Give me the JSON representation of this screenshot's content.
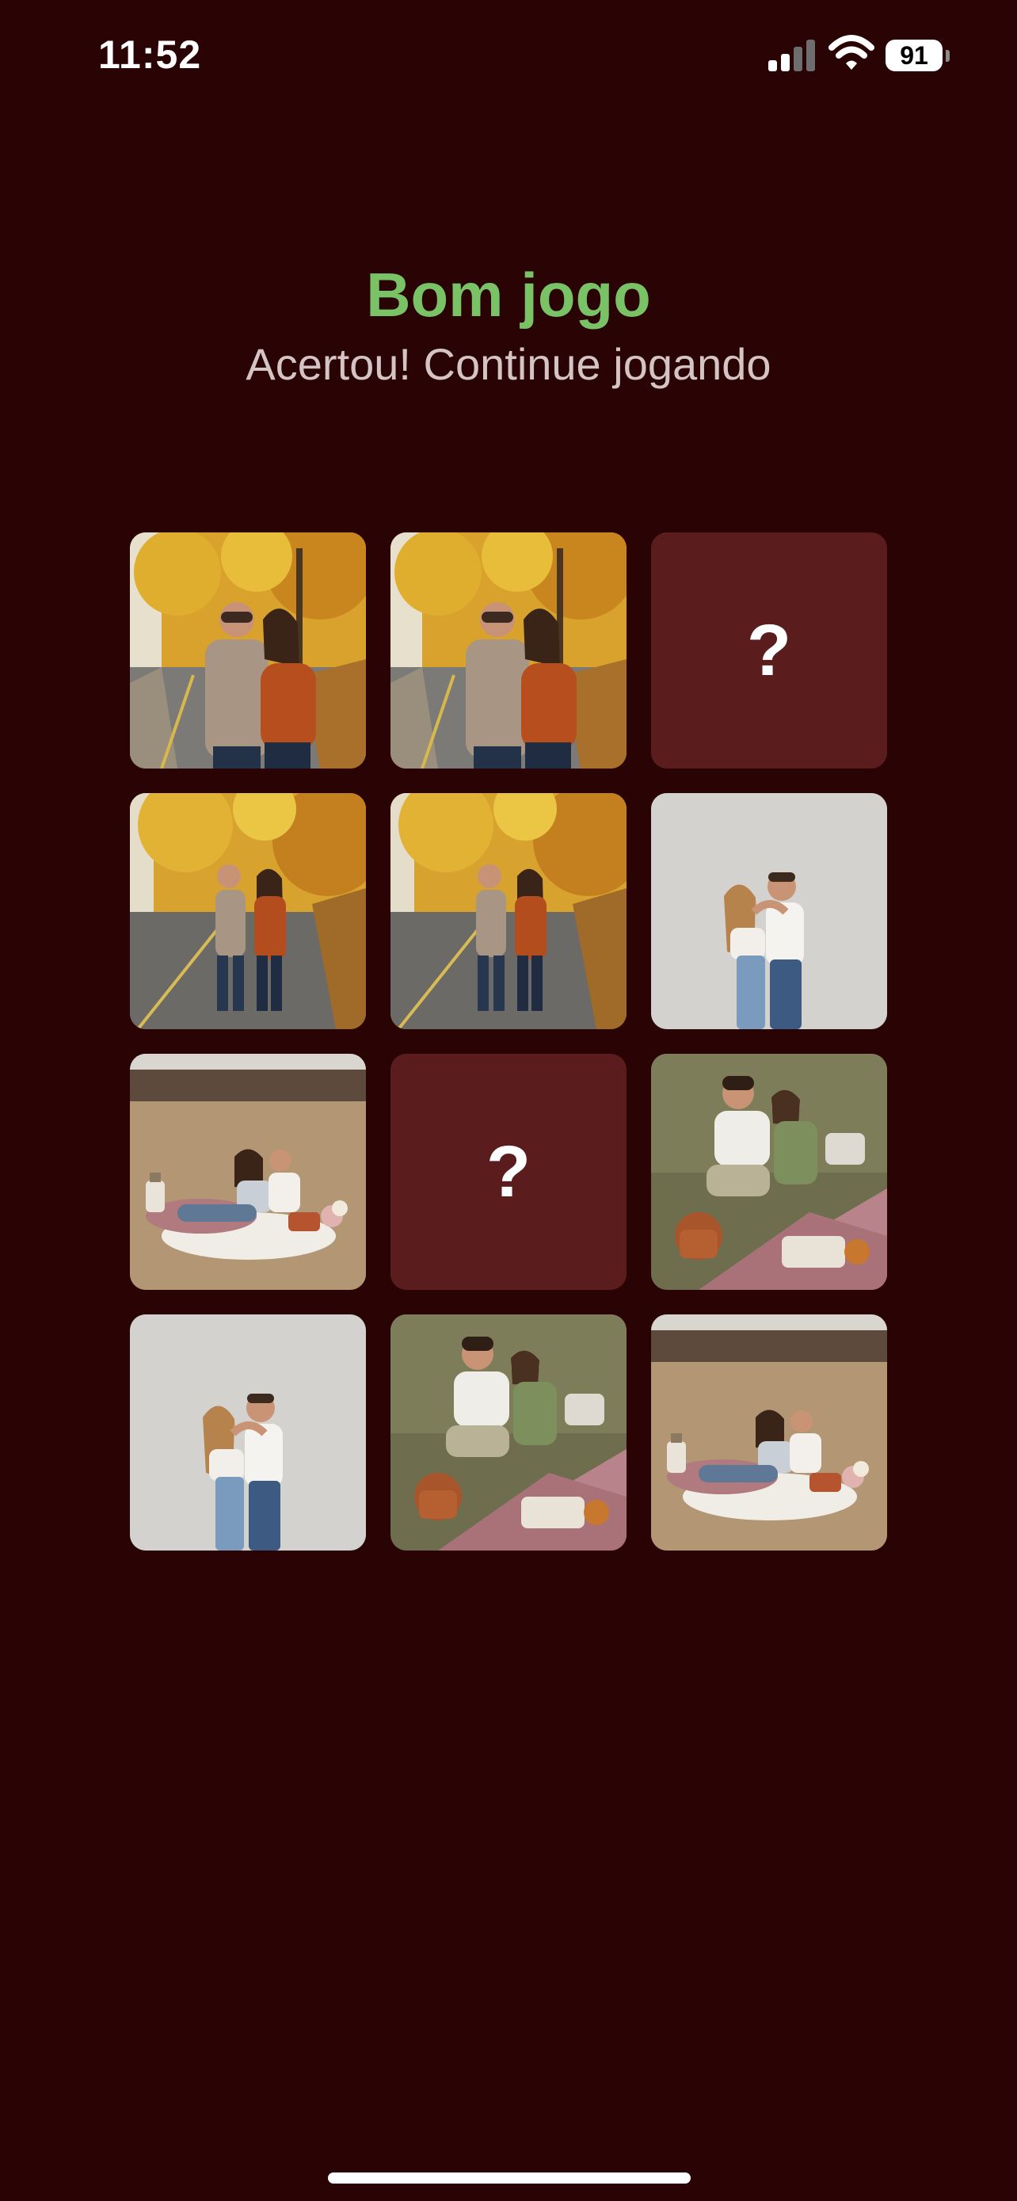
{
  "status_bar": {
    "time": "11:52",
    "battery": "91",
    "icons": [
      "signal-icon",
      "wifi-icon",
      "battery-icon"
    ]
  },
  "header": {
    "title": "Bom jogo",
    "subtitle": "Acertou! Continue jogando"
  },
  "board": {
    "cards": [
      {
        "state": "revealed",
        "photo": "couple-autumn-road-closeup"
      },
      {
        "state": "revealed",
        "photo": "couple-autumn-road-closeup"
      },
      {
        "state": "hidden",
        "label": "?"
      },
      {
        "state": "revealed",
        "photo": "couple-autumn-road-wide"
      },
      {
        "state": "revealed",
        "photo": "couple-autumn-road-wide"
      },
      {
        "state": "revealed",
        "photo": "couple-studio-embrace"
      },
      {
        "state": "revealed",
        "photo": "couple-field-picnic"
      },
      {
        "state": "hidden",
        "label": "?"
      },
      {
        "state": "revealed",
        "photo": "couple-grass-picnic"
      },
      {
        "state": "revealed",
        "photo": "couple-studio-embrace"
      },
      {
        "state": "revealed",
        "photo": "couple-grass-picnic"
      },
      {
        "state": "revealed",
        "photo": "couple-field-picnic"
      }
    ]
  },
  "colors": {
    "background": "#2a0304",
    "title": "#79c366",
    "subtitle": "#d4c4c4",
    "hidden_card": "#5b1c1d"
  }
}
